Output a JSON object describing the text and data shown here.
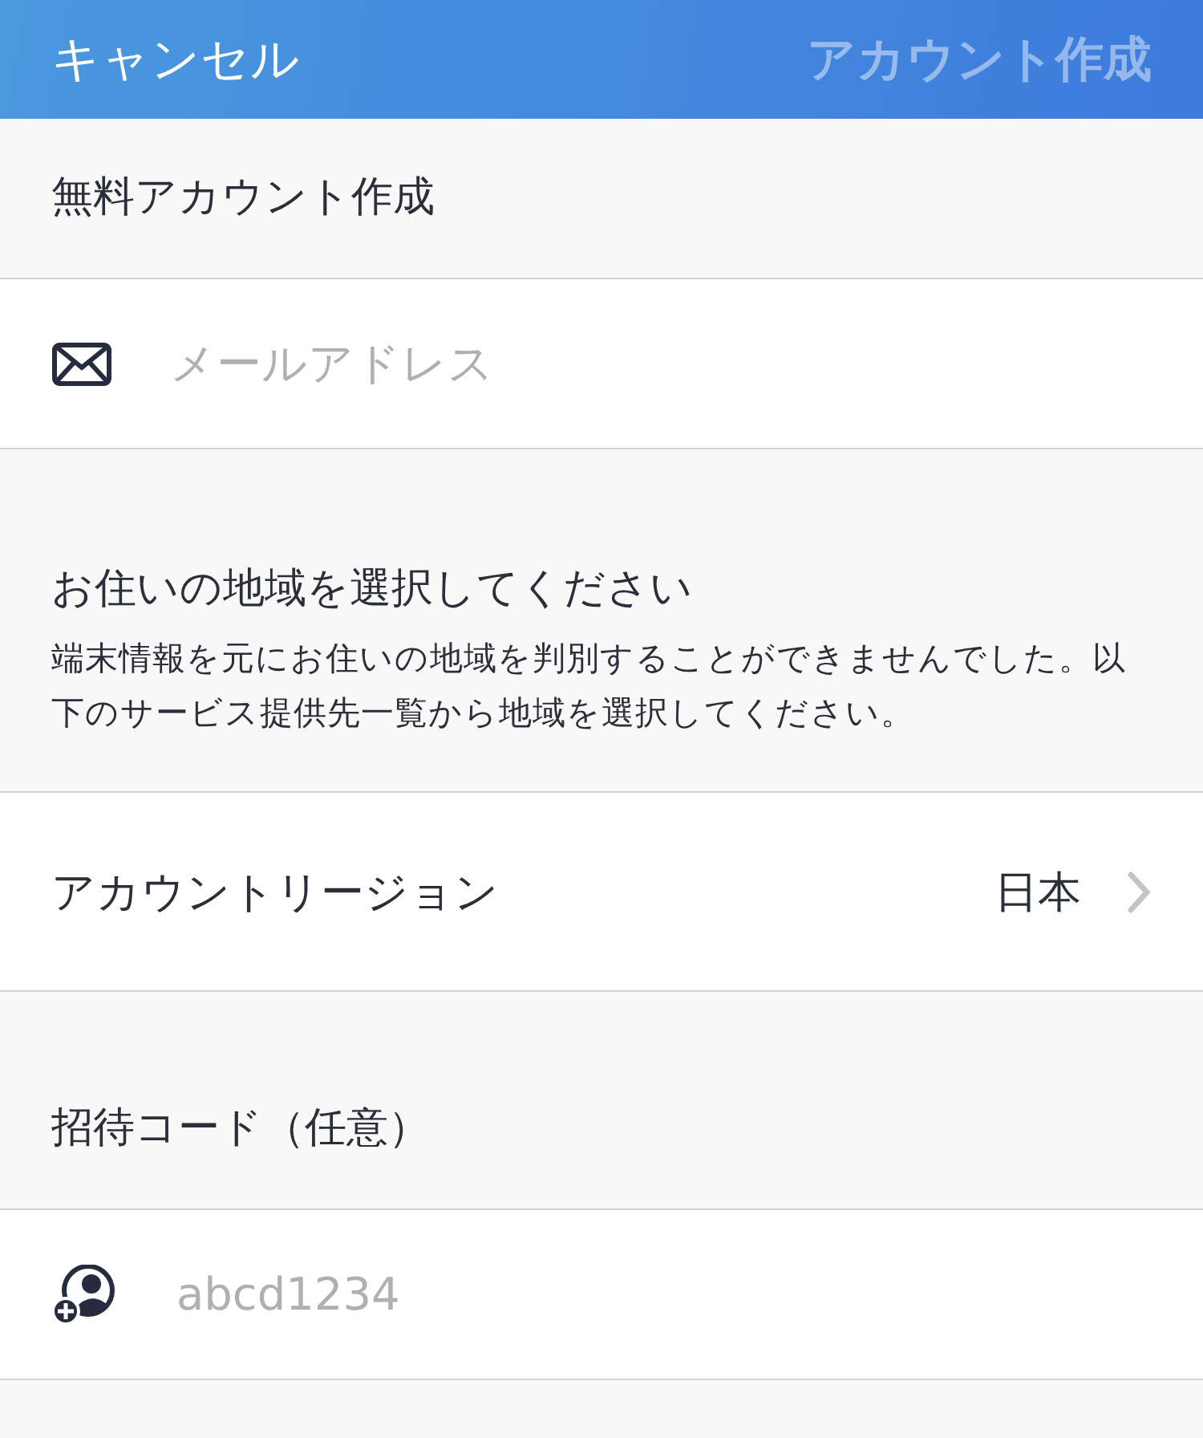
{
  "nav_bar": {
    "cancel": "キャンセル",
    "submit": {
      "label": "アカウント作成",
      "disabled": true
    }
  },
  "sections": [
    {
      "kind": "heading",
      "title": "無料アカウント作成"
    },
    {
      "kind": "input",
      "placeholder": "メールアドレス"
    },
    {
      "kind": "heading",
      "title": "お住いの地域を選択してください",
      "description": "端末情報を元にお住いの地域を判別することができませんでした。以下のサービス提供先一覧から地域を選択してください。"
    },
    {
      "kind": "select",
      "label": "アカウントリージョン",
      "value": "日本"
    },
    {
      "kind": "heading",
      "title": "招待コード（任意）"
    },
    {
      "kind": "input",
      "placeholder": "abcd1234"
    }
  ]
}
